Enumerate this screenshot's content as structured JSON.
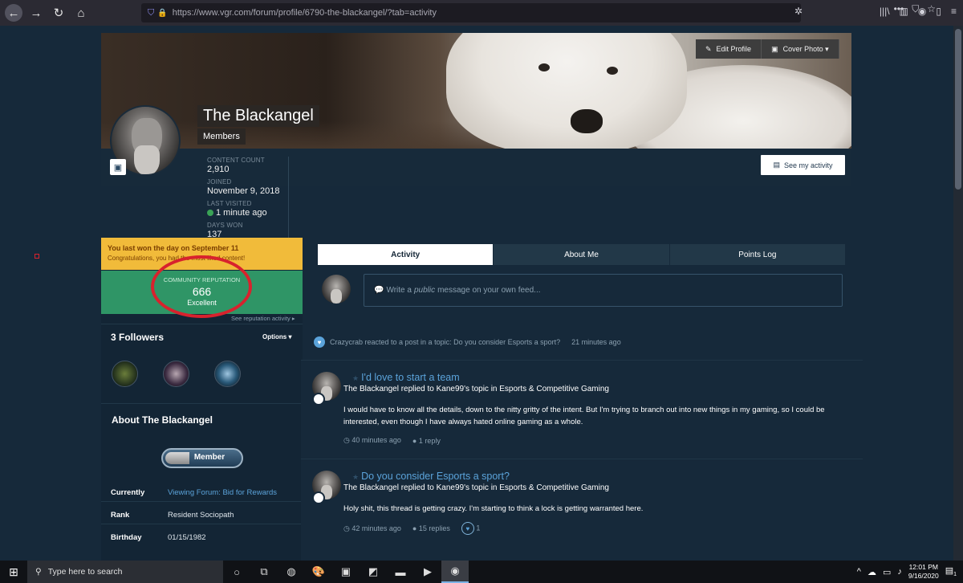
{
  "browser": {
    "url": "https://www.vgr.com/forum/profile/6790-the-blackangel/?tab=activity"
  },
  "cover": {
    "edit_profile": "Edit Profile",
    "cover_photo": "Cover Photo ▾"
  },
  "profile": {
    "name": "The Blackangel",
    "group": "Members",
    "see_activity": "See my activity",
    "stats": [
      {
        "label": "CONTENT COUNT",
        "value": "2,910"
      },
      {
        "label": "JOINED",
        "value": "November 9, 2018"
      },
      {
        "label": "LAST VISITED",
        "value": "1 minute ago"
      },
      {
        "label": "DAYS WON",
        "value": "137"
      }
    ]
  },
  "sidebar": {
    "won_title": "You last won the day on September 11",
    "won_sub": "Congratulations, you had the most liked content!",
    "rep_label": "COMMUNITY REPUTATION",
    "rep_value": "666",
    "rep_word": "Excellent",
    "see_rep": "See reputation activity ▸",
    "followers_title": "3 Followers",
    "options": "Options ▾",
    "about_title": "About The Blackangel",
    "member_badge": "Member",
    "info": [
      {
        "key": "Currently",
        "value": "Viewing Forum: Bid for Rewards"
      },
      {
        "key": "Rank",
        "value": "Resident Sociopath"
      },
      {
        "key": "Birthday",
        "value": "01/15/1982"
      }
    ]
  },
  "tabs": [
    {
      "label": "Activity"
    },
    {
      "label": "About Me"
    },
    {
      "label": "Points Log"
    }
  ],
  "feed": {
    "input_prefix": "Write a ",
    "input_em": "public",
    "input_suffix": " message on your own feed...",
    "reaction": "Crazycrab reacted to a post in a topic: Do you consider Esports a sport?",
    "reaction_time": "21 minutes ago",
    "posts": [
      {
        "title": "I'd love to start a team",
        "meta": "The Blackangel replied to Kane99's topic in Esports & Competitive Gaming",
        "body": "I would have to know all the details, down to the nitty gritty of the intent. But I'm trying to branch out into new things in my gaming, so I could be interested, even though I have always hated online gaming as a whole.",
        "time": "40 minutes ago",
        "replies": "1 reply"
      },
      {
        "title": "Do you consider Esports a sport?",
        "meta": "The Blackangel replied to Kane99's topic in Esports & Competitive Gaming",
        "body": "Holy shit, this thread is getting crazy. I'm starting to think a lock is getting warranted here.",
        "time": "42 minutes ago",
        "replies": "15 replies",
        "likes": "1"
      }
    ]
  },
  "taskbar": {
    "search": "Type here to search",
    "time": "12:01 PM",
    "date": "9/16/2020",
    "notif": "1"
  }
}
